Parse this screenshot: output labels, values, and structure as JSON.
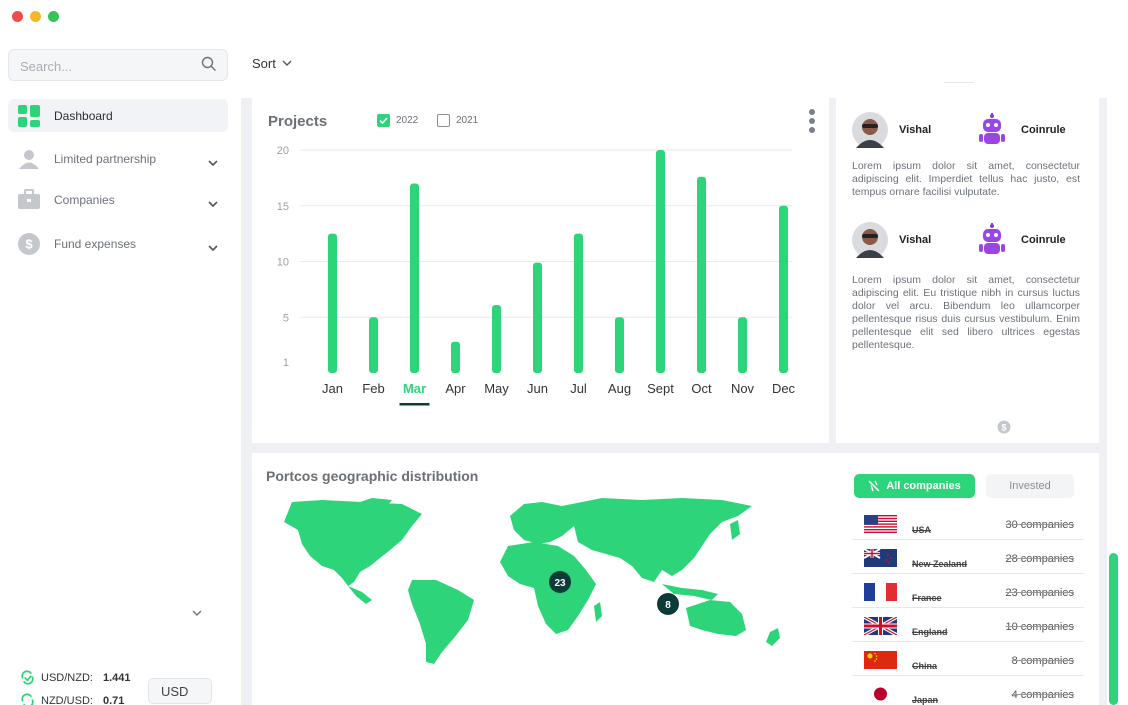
{
  "colors": {
    "accent": "#2ed47a",
    "map_marker": "#0d3b38",
    "traffic_red": "#ee4c4b",
    "traffic_yellow": "#f5b72a",
    "traffic_green": "#39c25a"
  },
  "search": {
    "placeholder": "Search..."
  },
  "sidebar": {
    "items": [
      {
        "label": "Dashboard",
        "icon": "dashboard-grid-icon",
        "active": true
      },
      {
        "label": "Limited partnership",
        "icon": "user-icon"
      },
      {
        "label": "Companies",
        "icon": "briefcase-icon"
      },
      {
        "label": "Fund expenses",
        "icon": "dollar-coin-icon"
      }
    ]
  },
  "toolbar": {
    "sort_label": "Sort"
  },
  "rates": [
    {
      "pair": "USD/NZD:",
      "value": "1.441"
    },
    {
      "pair": "NZD/USD:",
      "value": "0.71"
    }
  ],
  "currency": {
    "selected": "USD"
  },
  "projects": {
    "title": "Projects",
    "legend": [
      {
        "label": "2022",
        "checked": true
      },
      {
        "label": "2021",
        "checked": false
      }
    ]
  },
  "chart_data": {
    "type": "bar",
    "categories": [
      "Jan",
      "Feb",
      "Mar",
      "Apr",
      "May",
      "Jun",
      "Jul",
      "Aug",
      "Sept",
      "Oct",
      "Nov",
      "Dec"
    ],
    "series": [
      {
        "name": "2022",
        "values": [
          12.5,
          5,
          17,
          2.8,
          6.1,
          9.9,
          12.5,
          5,
          20,
          17.6,
          5,
          15
        ]
      }
    ],
    "yticks": [
      "20",
      "15",
      "10",
      "5",
      "1"
    ],
    "ylim": [
      0,
      20
    ],
    "selected_category": "Mar",
    "grid": true,
    "color": "#2ed47a"
  },
  "feed": [
    {
      "person": "Vishal",
      "company": "Coinrule",
      "text": "Lorem ipsum dolor sit amet, consectetur adipiscing elit. Imperdiet tellus hac justo, est tempus ornare facilisi vulputate."
    },
    {
      "person": "Vishal",
      "company": "Coinrule",
      "text": "Lorem ipsum dolor sit amet, consectetur adipiscing elit. Eu tristique nibh in cursus luctus dolor vel arcu. Bibendum leo ullamcorper pellentesque risus duis cursus vestibulum. Enim pellentesque elit sed libero ultrices egestas pellentesque."
    }
  ],
  "map": {
    "title": "Portcos geographic distribution",
    "markers": [
      {
        "label": "23"
      },
      {
        "label": "8"
      }
    ]
  },
  "company_filter": {
    "all_label": "All companies",
    "invested_label": "Invested"
  },
  "countries": [
    {
      "name": "USA",
      "count": "30 companies",
      "flag": "flag-usa-icon"
    },
    {
      "name": "New Zealand",
      "count": "28 companies",
      "flag": "flag-new-zealand-icon"
    },
    {
      "name": "France",
      "count": "23 companies",
      "flag": "flag-france-icon"
    },
    {
      "name": "England",
      "count": "10 companies",
      "flag": "flag-england-icon"
    },
    {
      "name": "China",
      "count": "8 companies",
      "flag": "flag-china-icon"
    },
    {
      "name": "Japan",
      "count": "4 companies",
      "flag": "flag-japan-icon"
    }
  ]
}
